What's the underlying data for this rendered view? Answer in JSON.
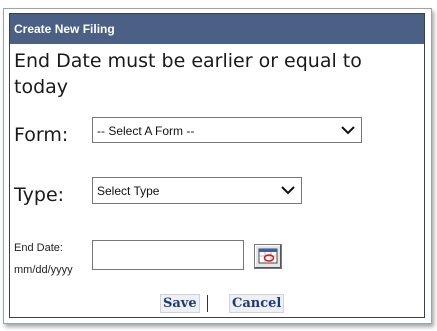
{
  "dialog": {
    "title": "Create New Filing",
    "message": "End Date must be earlier or equal to today"
  },
  "form": {
    "form_label": "Form:",
    "form_select_value": "-- Select A Form --",
    "type_label": "Type:",
    "type_select_value": "Select Type",
    "end_date_label": "End Date:",
    "end_date_format": "mm/dd/yyyy",
    "end_date_value": ""
  },
  "actions": {
    "save_label": "Save",
    "cancel_label": "Cancel",
    "separator": "|"
  },
  "colors": {
    "titlebar": "#4a6185",
    "button_text": "#1f3a78"
  },
  "icons": [
    "chevron-down-icon",
    "calendar-icon"
  ]
}
